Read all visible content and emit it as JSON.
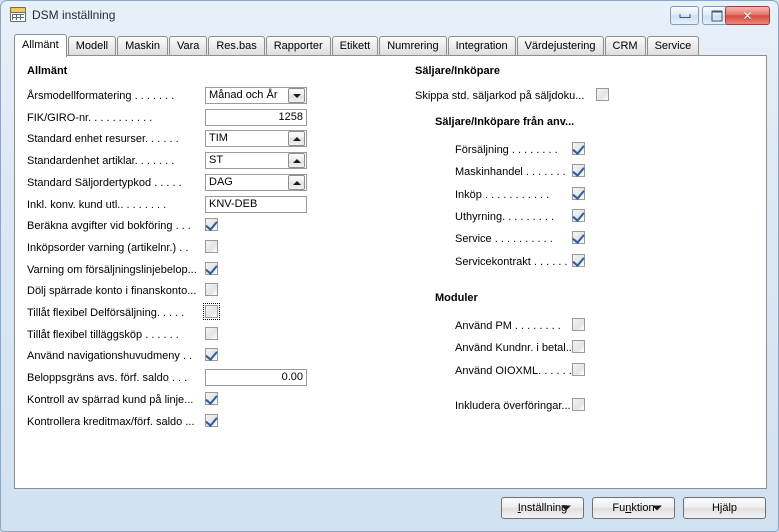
{
  "window": {
    "title": "DSM inställning",
    "icon": "table-icon",
    "minimize_label": "–",
    "maximize_label": "□",
    "close_label": "✕",
    "accent": "#d6e3f0",
    "close_color": "#d94a3c"
  },
  "tabs": [
    {
      "label": "Allmänt",
      "active": true
    },
    {
      "label": "Modell",
      "active": false
    },
    {
      "label": "Maskin",
      "active": false
    },
    {
      "label": "Vara",
      "active": false
    },
    {
      "label": "Res.bas",
      "active": false
    },
    {
      "label": "Rapporter",
      "active": false
    },
    {
      "label": "Etikett",
      "active": false
    },
    {
      "label": "Numrering",
      "active": false
    },
    {
      "label": "Integration",
      "active": false
    },
    {
      "label": "Värdejustering",
      "active": false
    },
    {
      "label": "CRM",
      "active": false
    },
    {
      "label": "Service",
      "active": false
    }
  ],
  "left": {
    "heading": "Allmänt",
    "rows": [
      {
        "label": "Årsmodellformatering  .  .  .  .  .  .  .",
        "type": "dropdown",
        "value": "Månad och År"
      },
      {
        "label": "FIK/GIRO-nr.  .  .  .  .  .  .  .  .  .  .",
        "type": "text-num",
        "value": "1258"
      },
      {
        "label": "Standard enhet resurser.  .  .  .  .  .",
        "type": "lookup",
        "value": "TIM"
      },
      {
        "label": "Standardenhet artiklar.  .  .  .  .  .  .",
        "type": "lookup",
        "value": "ST"
      },
      {
        "label": "Standard Säljordertypkod  .  .  .  .  .",
        "type": "lookup",
        "value": "DAG"
      },
      {
        "label": "Inkl. konv. kund utl..  .  .  .  .  .  .  .",
        "type": "text",
        "value": "KNV-DEB"
      },
      {
        "label": "Beräkna avgifter vid bokföring  .  .  .",
        "type": "checkbox",
        "checked": true
      },
      {
        "label": "Inköpsorder varning (artikelnr.)  .  .",
        "type": "checkbox",
        "checked": false
      },
      {
        "label": "Varning om försäljningslinjebelop...",
        "type": "checkbox",
        "checked": true
      },
      {
        "label": "Dölj spärrade konto i finanskonto...",
        "type": "checkbox",
        "checked": false
      },
      {
        "label": "Tillåt flexibel Delförsäljning.  .  .  .  .",
        "type": "checkbox",
        "checked": false,
        "focused": true
      },
      {
        "label": "Tillåt flexibel tilläggsköp  .  .  .  .  .  .",
        "type": "checkbox",
        "checked": false
      },
      {
        "label": "Använd navigationshuvudmeny  .  .",
        "type": "checkbox",
        "checked": true
      },
      {
        "label": "Beloppsgräns avs. förf. saldo  .  .  .",
        "type": "text-num",
        "value": "0.00"
      },
      {
        "label": "Kontroll av spärrad kund på linje...",
        "type": "checkbox",
        "checked": true
      },
      {
        "label": "Kontrollera kreditmax/förf. saldo  ...",
        "type": "checkbox",
        "checked": true
      }
    ]
  },
  "right": {
    "heading": "Säljare/Inköpare",
    "skip_row": {
      "label": "Skippa std. säljarkod på säljdoku...",
      "checked": false
    },
    "subheading": "Säljare/Inköpare från anv...",
    "source_rows": [
      {
        "label": "Försäljning  .  .  .  .  .  .  .  .",
        "checked": true
      },
      {
        "label": "Maskinhandel  .  .  .  .  .  .  .",
        "checked": true
      },
      {
        "label": "Inköp .  .  .  .  .  .  .  .  .  .  .",
        "checked": true
      },
      {
        "label": "Uthyrning.  .  .  .  .  .  .  .  .",
        "checked": true
      },
      {
        "label": "Service  .  .  .  .  .  .  .  .  .  .",
        "checked": true
      },
      {
        "label": "Servicekontrakt  .  .  .  .  .  .",
        "checked": true
      }
    ],
    "modules_heading": "Moduler",
    "module_rows": [
      {
        "label": "Använd PM  .  .  .  .  .  .  .  .",
        "checked": false
      },
      {
        "label": "Använd Kundnr. i betal...",
        "checked": false
      },
      {
        "label": "Använd OIOXML.  .  .  .  .  .",
        "checked": false
      },
      {
        "label": "Inkludera överföringar...",
        "checked": false
      }
    ]
  },
  "footer": {
    "settings_button": "Inställning",
    "settings_accesskey": "I",
    "function_button": "Funktion",
    "function_accesskey": "n",
    "help_button": "Hjälp"
  }
}
